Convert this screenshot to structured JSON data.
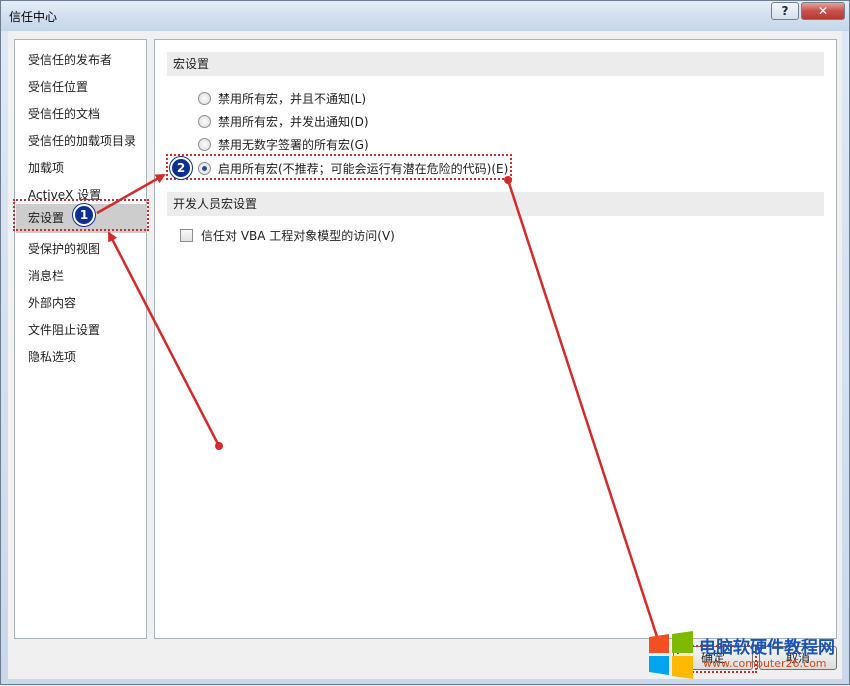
{
  "window": {
    "title": "信任中心",
    "help_label": "?",
    "close_label": "✕"
  },
  "sidebar": {
    "items": [
      {
        "label": "受信任的发布者"
      },
      {
        "label": "受信任位置"
      },
      {
        "label": "受信任的文档"
      },
      {
        "label": "受信任的加载项目录"
      },
      {
        "label": "加载项"
      },
      {
        "label": "ActiveX 设置"
      },
      {
        "label": "宏设置",
        "selected": true
      },
      {
        "label": "受保护的视图"
      },
      {
        "label": "消息栏"
      },
      {
        "label": "外部内容"
      },
      {
        "label": "文件阻止设置"
      },
      {
        "label": "隐私选项"
      }
    ]
  },
  "macro_settings": {
    "header": "宏设置",
    "options": [
      {
        "label": "禁用所有宏，并且不通知(L)",
        "checked": false
      },
      {
        "label": "禁用所有宏，并发出通知(D)",
        "checked": false
      },
      {
        "label": "禁用无数字签署的所有宏(G)",
        "checked": false
      },
      {
        "label": "启用所有宏(不推荐；可能会运行有潜在危险的代码)(E)",
        "checked": true
      }
    ]
  },
  "developer_settings": {
    "header": "开发人员宏设置",
    "vba_trust_label": "信任对 VBA 工程对象模型的访问(V)",
    "vba_trust_checked": false
  },
  "footer": {
    "ok_label": "确定",
    "cancel_label": "取消"
  },
  "annotations": {
    "badge1": "1",
    "badge2": "2",
    "annotation_color": "#d42a2a",
    "badge_color": "#0d2f8f"
  },
  "watermark": {
    "title": "电脑软硬件教程网",
    "url": "www.computer26.com"
  }
}
